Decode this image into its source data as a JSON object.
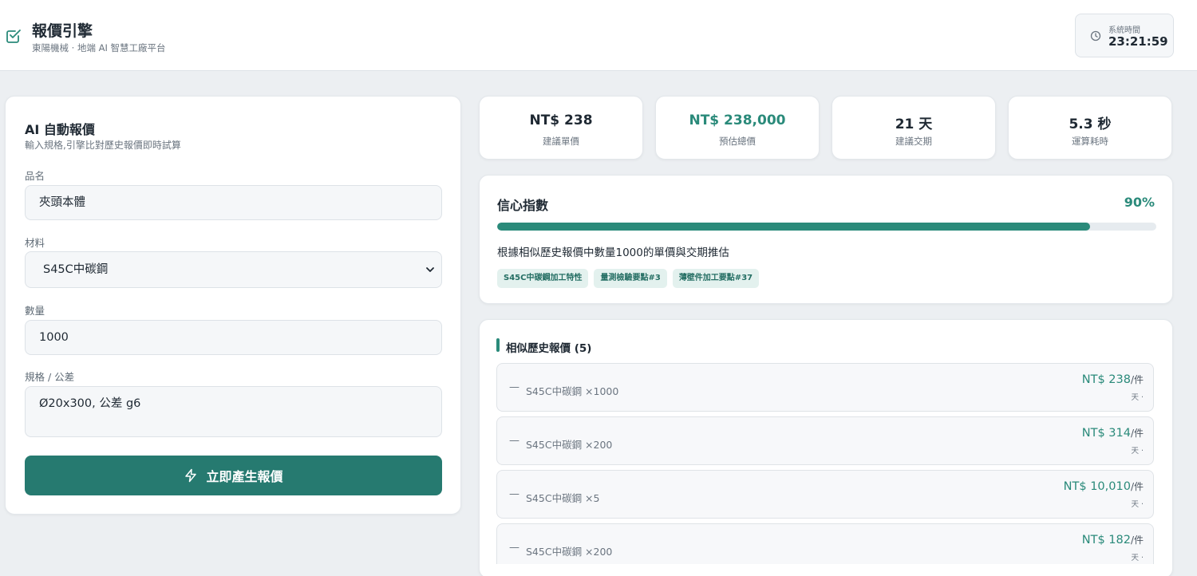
{
  "header": {
    "title": "報價引擎",
    "subtitle": "東陽機械 · 地端 AI 智慧工廠平台",
    "clock_label": "系統時間",
    "clock_time": "23:21:59"
  },
  "form": {
    "title": "AI 自動報價",
    "subtitle": "輸入規格,引擎比對歷史報價即時試算",
    "product_label": "品名",
    "product_value": "夾頭本體",
    "material_label": "材料",
    "material_value": "S45C中碳鋼",
    "quantity_label": "數量",
    "quantity_value": "1000",
    "spec_label": "規格 / 公差",
    "spec_value": "Ø20x300, 公差 g6",
    "submit_label": "立即產生報價"
  },
  "stats": [
    {
      "value": "NT$ 238",
      "label": "建議單價"
    },
    {
      "value": "NT$ 238,000",
      "label": "預估總價"
    },
    {
      "value": "21 天",
      "label": "建議交期"
    },
    {
      "value": "5.3 秒",
      "label": "運算耗時"
    }
  ],
  "confidence": {
    "title": "信心指數",
    "value_text": "90%",
    "value": 0.9,
    "description": "根據相似歷史報價中數量1000的單價與交期推估",
    "tags": [
      "S45C中碳鋼加工特性",
      "量測檢驗要點#3",
      "薄壁件加工要點#37"
    ]
  },
  "history": {
    "title": "相似歷史報價 (5)",
    "items": [
      {
        "dash": "—",
        "desc": "S45C中碳鋼 ×1000",
        "price": "NT$ 238",
        "unit": "/件",
        "sub": "天 ·"
      },
      {
        "dash": "—",
        "desc": "S45C中碳鋼 ×200",
        "price": "NT$ 314",
        "unit": "/件",
        "sub": "天 ·"
      },
      {
        "dash": "—",
        "desc": "S45C中碳鋼 ×5",
        "price": "NT$ 10,010",
        "unit": "/件",
        "sub": "天 ·"
      },
      {
        "dash": "—",
        "desc": "S45C中碳鋼 ×200",
        "price": "NT$ 182",
        "unit": "/件",
        "sub": "天 ·"
      }
    ]
  },
  "colors": {
    "accent": "#2a8a7a",
    "button": "#267a70",
    "background": "#eceff2"
  },
  "icons": {
    "logo": "checkbox-icon",
    "clock": "clock-icon",
    "submit": "bolt-icon",
    "select": "chevron-down-icon"
  }
}
